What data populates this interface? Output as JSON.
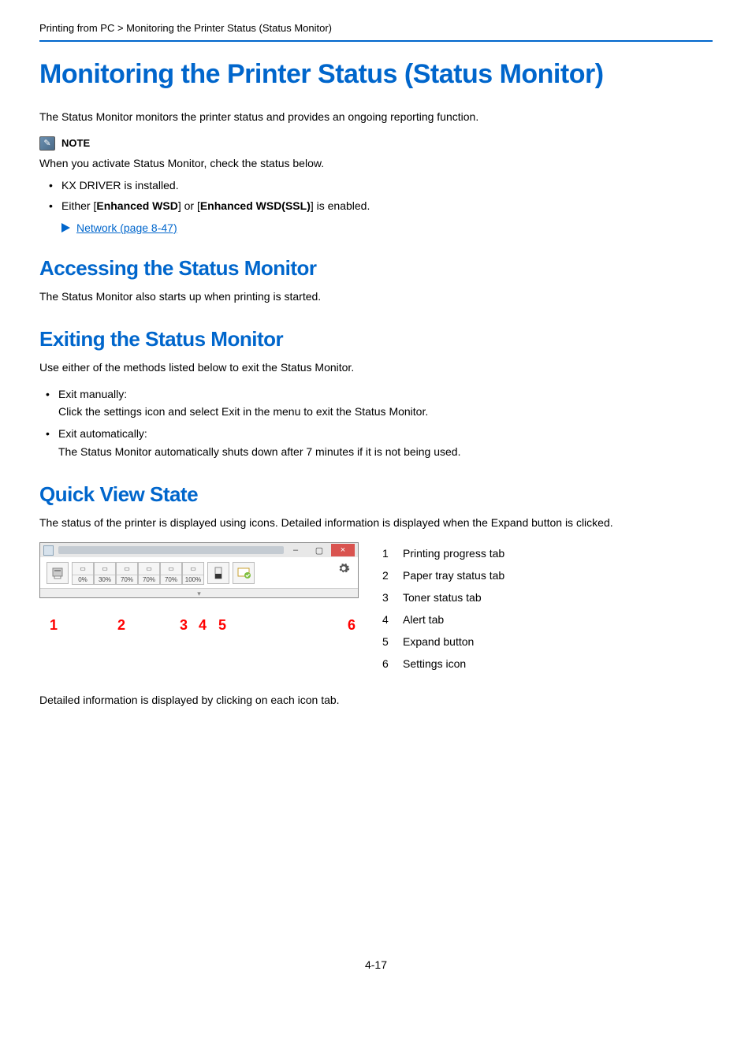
{
  "breadcrumb": "Printing from PC > Monitoring the Printer Status (Status Monitor)",
  "title": "Monitoring the Printer Status (Status Monitor)",
  "intro": "The Status Monitor monitors the printer status and provides an ongoing reporting function.",
  "note": {
    "label": "NOTE",
    "body": "When you activate Status Monitor, check the status below.",
    "items": [
      "KX DRIVER is installed.",
      "Either [Enhanced WSD] or [Enhanced WSD(SSL)] is enabled."
    ],
    "link": "Network (page 8-47)"
  },
  "section_access": {
    "heading": "Accessing the Status Monitor",
    "body": "The Status Monitor also starts up when printing is started."
  },
  "section_exit": {
    "heading": "Exiting the Status Monitor",
    "body": "Use either of the methods listed below to exit the Status Monitor.",
    "items": [
      {
        "head": "Exit manually:",
        "desc": "Click the settings icon and select Exit in the menu to exit the Status Monitor."
      },
      {
        "head": "Exit automatically:",
        "desc": "The Status Monitor automatically shuts down after 7 minutes if it is not being used."
      }
    ]
  },
  "section_qv": {
    "heading": "Quick View State",
    "body": "The status of the printer is displayed using icons. Detailed information is displayed when the Expand button is clicked.",
    "legend": [
      {
        "n": "1",
        "label": "Printing progress tab"
      },
      {
        "n": "2",
        "label": "Paper tray status tab"
      },
      {
        "n": "3",
        "label": "Toner status tab"
      },
      {
        "n": "4",
        "label": "Alert tab"
      },
      {
        "n": "5",
        "label": "Expand button"
      },
      {
        "n": "6",
        "label": "Settings icon"
      }
    ],
    "trays": [
      "0%",
      "30%",
      "70%",
      "70%",
      "70%",
      "100%"
    ],
    "footer": "Detailed information is displayed by clicking on each icon tab."
  },
  "page_number": "4-17"
}
